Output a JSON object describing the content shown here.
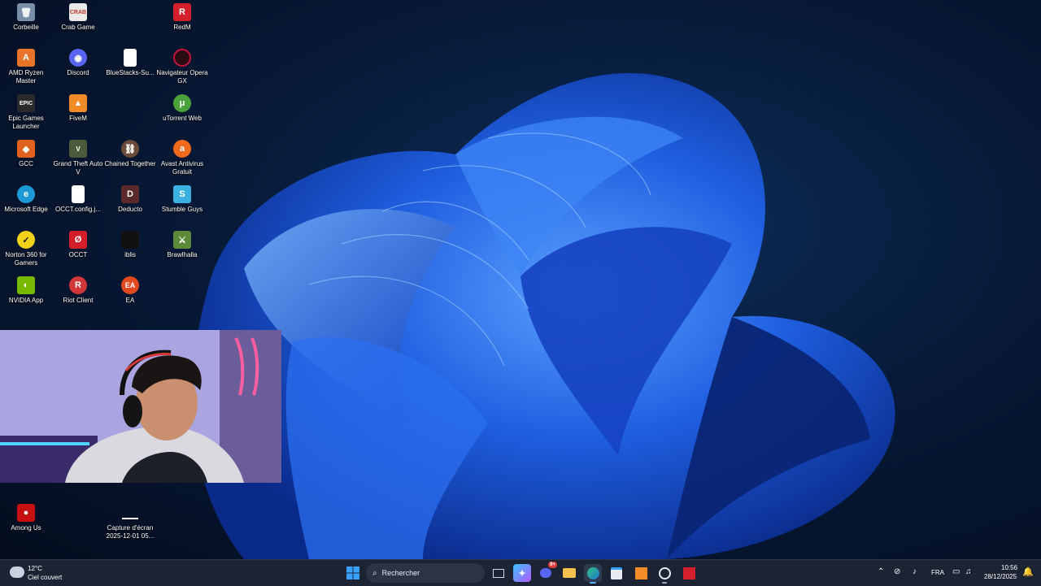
{
  "desktop": {
    "icons": [
      {
        "label": "Corbeille",
        "icon": "recycle-bin-icon",
        "color": "#7a8ea8"
      },
      {
        "label": "Crab Game",
        "icon": "crab-game-icon",
        "color": "#e9e9e9"
      },
      {
        "label": "RedM",
        "icon": "redm-icon",
        "color": "#d4202c"
      },
      {
        "label": "AMD Ryzen Master",
        "icon": "amd-ryzen-icon",
        "color": "#e8742a"
      },
      {
        "label": "Discord",
        "icon": "discord-icon",
        "color": "#5865f2"
      },
      {
        "label": "BlueStacks-Su...",
        "icon": "file-icon",
        "color": "#ffffff"
      },
      {
        "label": "Navigateur Opera GX",
        "icon": "opera-gx-icon",
        "color": "#c7123b"
      },
      {
        "label": "Epic Games Launcher",
        "icon": "epic-games-icon",
        "color": "#2a2a2a"
      },
      {
        "label": "FiveM",
        "icon": "fivem-icon",
        "color": "#f28c28"
      },
      {
        "label": "uTorrent Web",
        "icon": "utorrent-icon",
        "color": "#4aa33a"
      },
      {
        "label": "GCC",
        "icon": "gcc-icon",
        "color": "#e0621e"
      },
      {
        "label": "Grand Theft Auto V",
        "icon": "gta-icon",
        "color": "#4a5a3a"
      },
      {
        "label": "Chained Together",
        "icon": "chained-together-icon",
        "color": "#6a4a3a"
      },
      {
        "label": "Avast Antivirus Gratuit",
        "icon": "avast-icon",
        "color": "#ef6a1c"
      },
      {
        "label": "Microsoft Edge",
        "icon": "edge-icon",
        "color": "#1c9ad6"
      },
      {
        "label": "OCCT.config.j...",
        "icon": "file-icon",
        "color": "#ffffff"
      },
      {
        "label": "Deducto",
        "icon": "deducto-icon",
        "color": "#5a2a2a"
      },
      {
        "label": "Stumble Guys",
        "icon": "stumble-guys-icon",
        "color": "#3ab0e0"
      },
      {
        "label": "Norton 360 for Gamers",
        "icon": "norton-icon",
        "color": "#f1d21a"
      },
      {
        "label": "OCCT",
        "icon": "occt-icon",
        "color": "#d21f2a"
      },
      {
        "label": "iblis",
        "icon": "iblis-icon",
        "color": "#111111"
      },
      {
        "label": "Brawlhalla",
        "icon": "brawlhalla-icon",
        "color": "#5c8a3a"
      },
      {
        "label": "NVIDIA App",
        "icon": "nvidia-icon",
        "color": "#76b900"
      },
      {
        "label": "Riot Client",
        "icon": "riot-icon",
        "color": "#d13639"
      },
      {
        "label": "EA",
        "icon": "ea-icon",
        "color": "#e0491e"
      },
      {
        "label": "Among Us",
        "icon": "among-us-icon",
        "color": "#c51111"
      },
      {
        "label": "Capture d'écran 2025-12-01 05...",
        "icon": "screenshot-file-icon",
        "color": "#ffffff"
      }
    ]
  },
  "taskbar": {
    "weather_temp": "12°C",
    "weather_desc": "Ciel couvert",
    "search_placeholder": "Rechercher",
    "discord_badge": "9+",
    "language": "FRA",
    "time": "10:56",
    "date": "28/12/2025",
    "accent": "#0a84ff"
  }
}
